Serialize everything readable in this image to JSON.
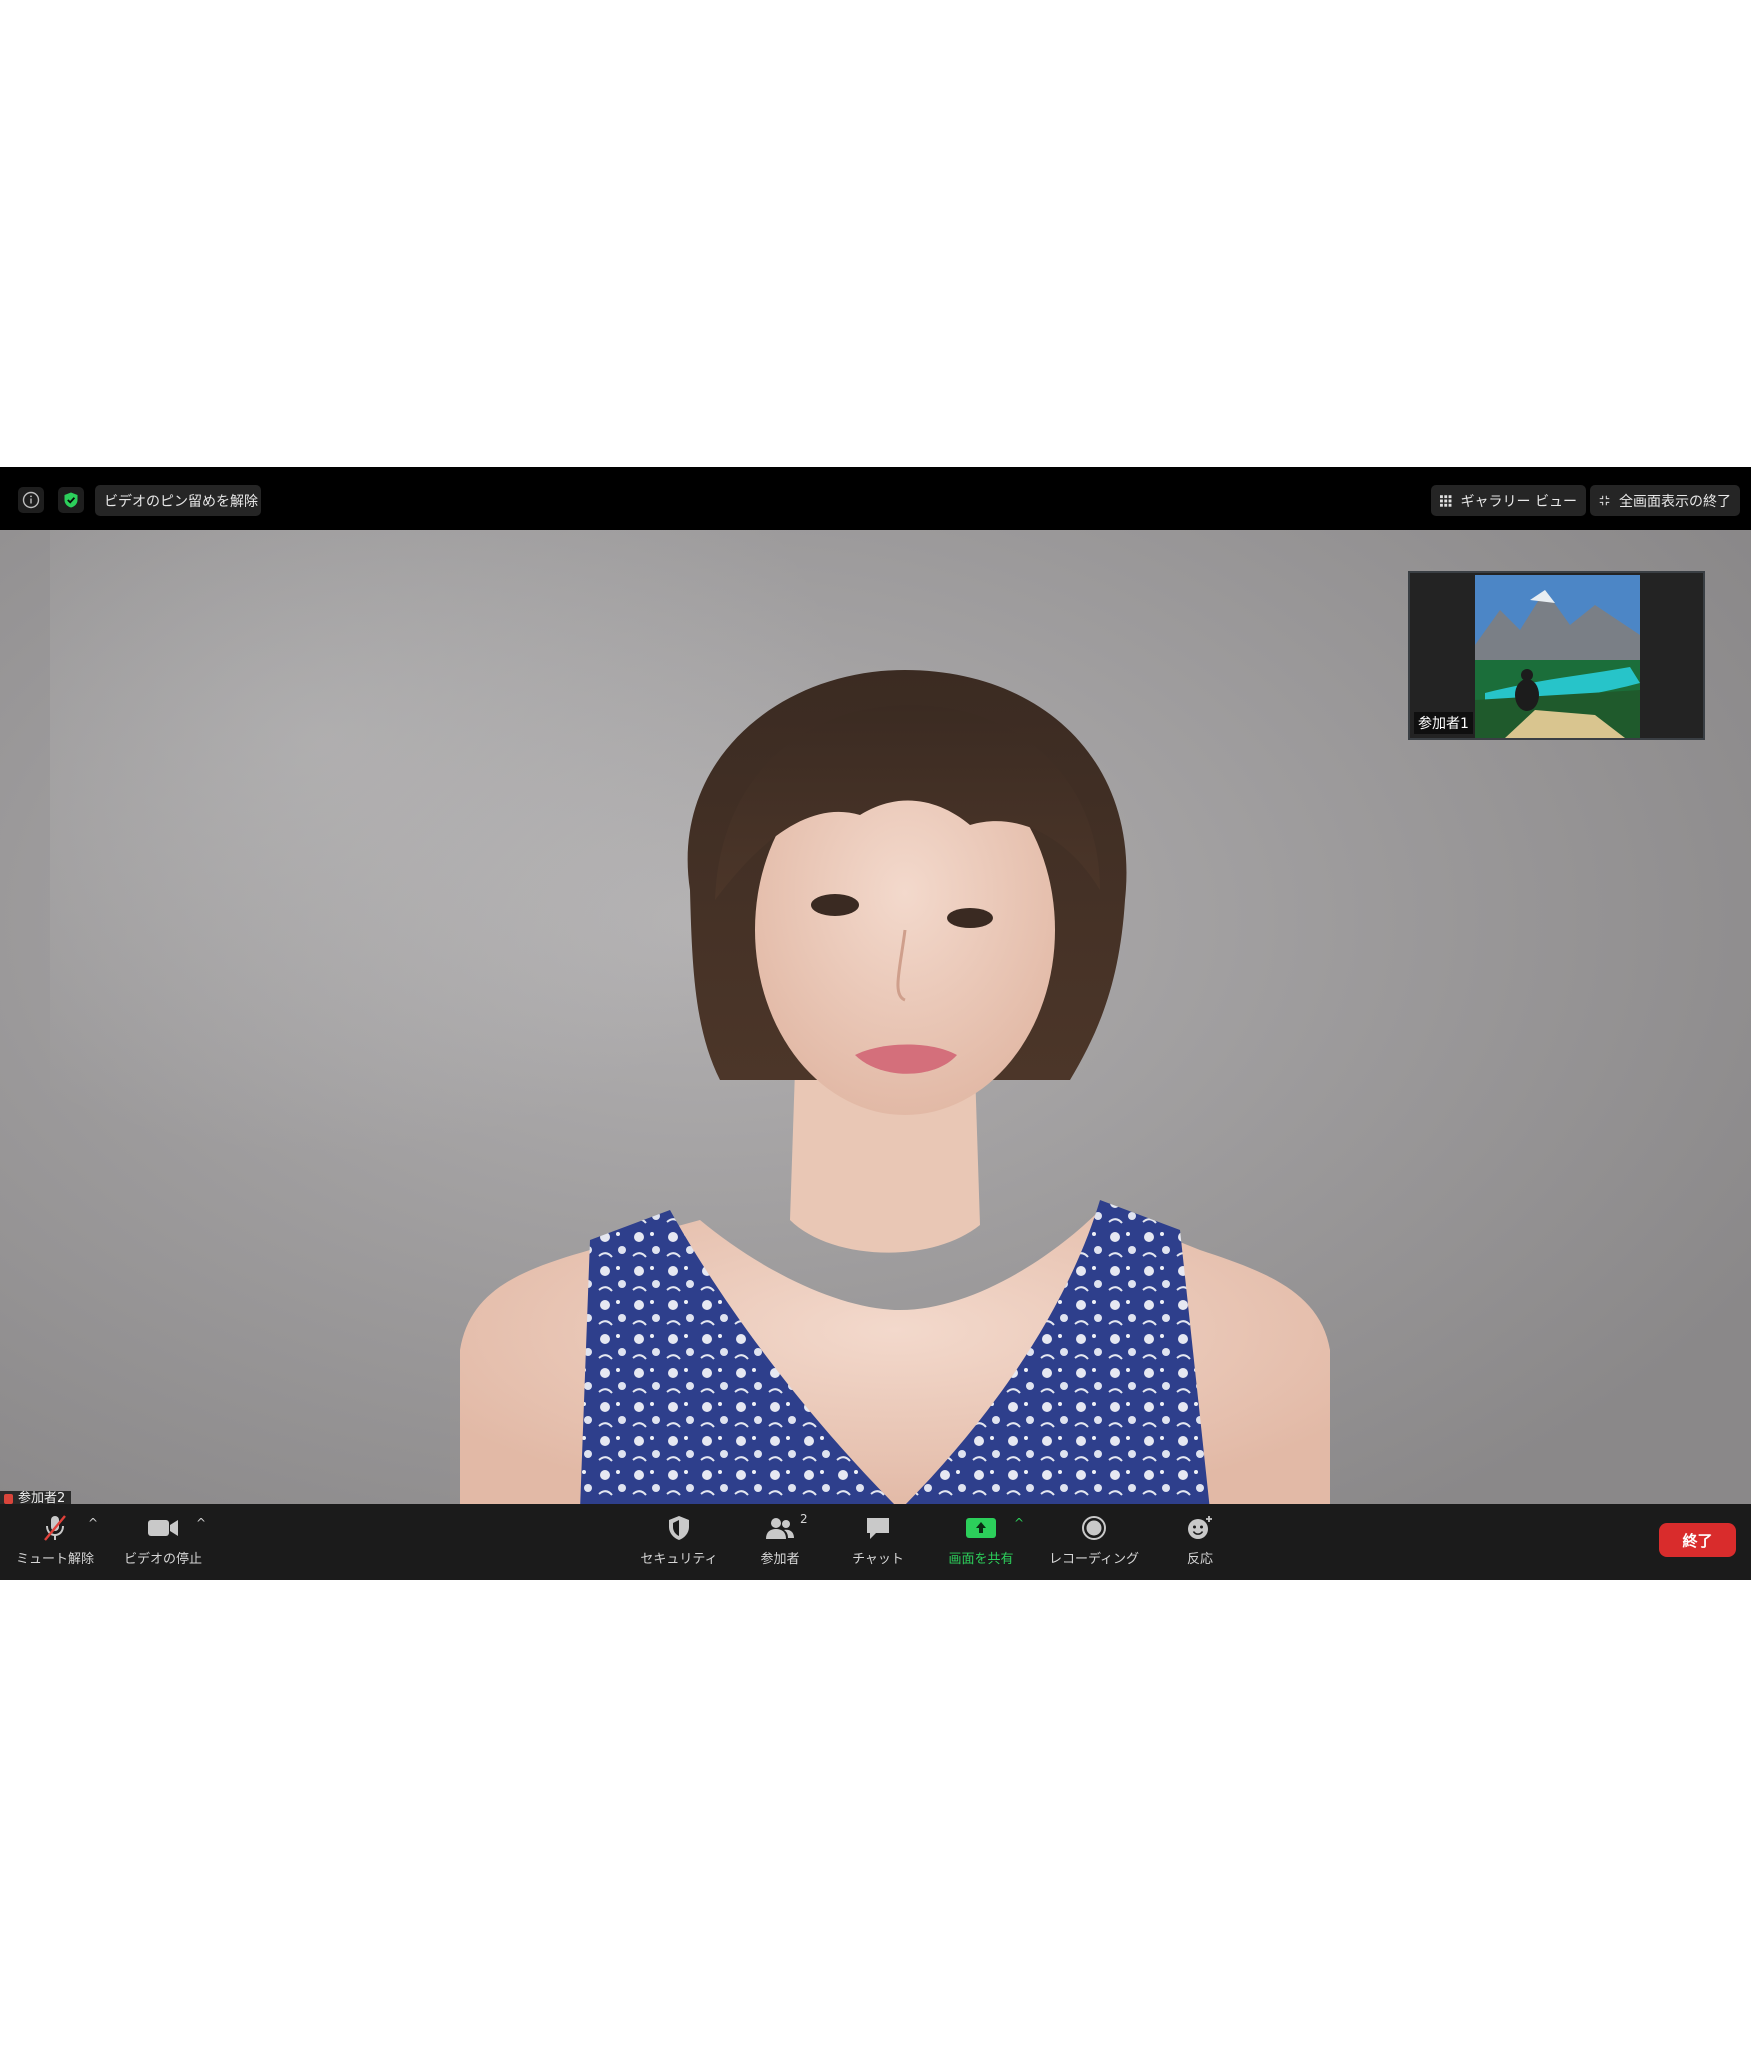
{
  "topbar": {
    "unpin_label": "ビデオのピン留めを解除",
    "gallery_label": "ギャラリー ビュー",
    "exit_fullscreen_label": "全画面表示の終了"
  },
  "thumbnail": {
    "label": "参加者1"
  },
  "speaker": {
    "label": "参加者2"
  },
  "toolbar": {
    "mute_label": "ミュート解除",
    "video_label": "ビデオの停止",
    "security_label": "セキュリティ",
    "participants_label": "参加者",
    "participants_count": "2",
    "chat_label": "チャット",
    "share_label": "画面を共有",
    "recording_label": "レコーディング",
    "reactions_label": "反応",
    "end_label": "終了"
  },
  "colors": {
    "share_green": "#2ccf5b",
    "end_red": "#d92c2c",
    "shield_green": "#2ccf5b"
  },
  "icons": [
    "info-icon",
    "shield-check-icon",
    "grid-icon",
    "exit-fullscreen-icon",
    "mic-muted-icon",
    "video-camera-icon",
    "security-shield-icon",
    "participants-icon",
    "chat-icon",
    "share-screen-icon",
    "record-icon",
    "reaction-icon"
  ]
}
